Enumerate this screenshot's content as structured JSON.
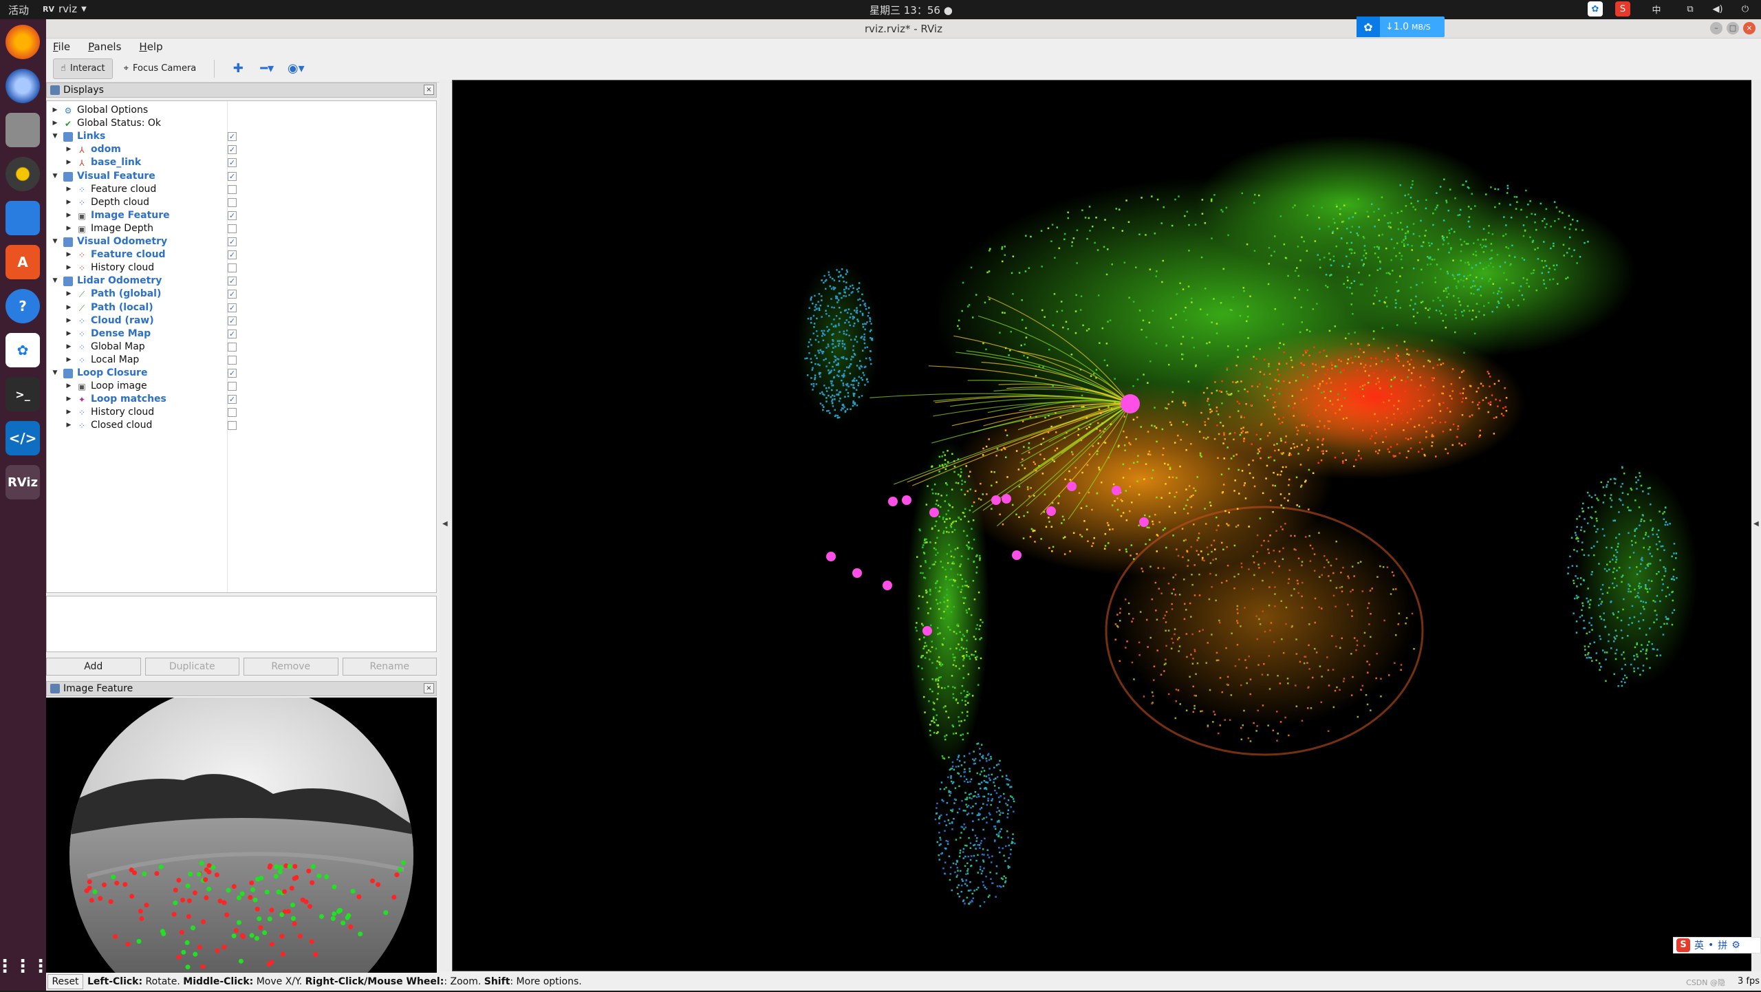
{
  "topbar": {
    "activities": "活动",
    "app_name": "rviz",
    "clock": "星期三 13：56 ●",
    "input_method": "中"
  },
  "window": {
    "title": "rviz.rviz* - RViz"
  },
  "menu": {
    "file": "File",
    "panels": "Panels",
    "help": "Help"
  },
  "toolbar": {
    "interact": "Interact",
    "focus_camera": "Focus Camera"
  },
  "netspeed": {
    "value": "↓1.0",
    "unit": "MB/S"
  },
  "displays_panel": {
    "title": "Displays",
    "rows": [
      {
        "label": "Global Options",
        "depth": 0,
        "expanded": false,
        "hl": false,
        "check": null,
        "icon": "gear-icon"
      },
      {
        "label": "Global Status: Ok",
        "depth": 0,
        "expanded": false,
        "hl": false,
        "check": null,
        "icon": "check-icon"
      },
      {
        "label": "Links",
        "depth": 0,
        "expanded": true,
        "hl": true,
        "check": true,
        "icon": "folder-icon"
      },
      {
        "label": "odom",
        "depth": 1,
        "expanded": false,
        "hl": true,
        "check": true,
        "icon": "axes-icon"
      },
      {
        "label": "base_link",
        "depth": 1,
        "expanded": false,
        "hl": true,
        "check": true,
        "icon": "axes-icon"
      },
      {
        "label": "Visual Feature",
        "depth": 0,
        "expanded": true,
        "hl": true,
        "check": true,
        "icon": "folder-icon"
      },
      {
        "label": "Feature cloud",
        "depth": 1,
        "expanded": false,
        "hl": false,
        "check": false,
        "icon": "pointcloud-icon"
      },
      {
        "label": "Depth cloud",
        "depth": 1,
        "expanded": false,
        "hl": false,
        "check": false,
        "icon": "pointcloud-icon"
      },
      {
        "label": "Image Feature",
        "depth": 1,
        "expanded": false,
        "hl": true,
        "check": true,
        "icon": "image-icon"
      },
      {
        "label": "Image Depth",
        "depth": 1,
        "expanded": false,
        "hl": false,
        "check": false,
        "icon": "image-icon"
      },
      {
        "label": "Visual Odometry",
        "depth": 0,
        "expanded": true,
        "hl": true,
        "check": true,
        "icon": "folder-icon"
      },
      {
        "label": "Feature cloud",
        "depth": 1,
        "expanded": false,
        "hl": true,
        "check": true,
        "icon": "pointcloud-red-icon"
      },
      {
        "label": "History cloud",
        "depth": 1,
        "expanded": false,
        "hl": false,
        "check": false,
        "icon": "pointcloud-red-icon"
      },
      {
        "label": "Lidar Odometry",
        "depth": 0,
        "expanded": true,
        "hl": true,
        "check": true,
        "icon": "folder-icon"
      },
      {
        "label": "Path (global)",
        "depth": 1,
        "expanded": false,
        "hl": true,
        "check": true,
        "icon": "path-icon"
      },
      {
        "label": "Path (local)",
        "depth": 1,
        "expanded": false,
        "hl": true,
        "check": true,
        "icon": "path-icon"
      },
      {
        "label": "Cloud (raw)",
        "depth": 1,
        "expanded": false,
        "hl": true,
        "check": true,
        "icon": "pointcloud-icon"
      },
      {
        "label": "Dense Map",
        "depth": 1,
        "expanded": false,
        "hl": true,
        "check": true,
        "icon": "pointcloud-icon"
      },
      {
        "label": "Global Map",
        "depth": 1,
        "expanded": false,
        "hl": false,
        "check": false,
        "icon": "pointcloud-icon"
      },
      {
        "label": "Local Map",
        "depth": 1,
        "expanded": false,
        "hl": false,
        "check": false,
        "icon": "pointcloud-icon"
      },
      {
        "label": "Loop Closure",
        "depth": 0,
        "expanded": true,
        "hl": true,
        "check": true,
        "icon": "folder-icon"
      },
      {
        "label": "Loop image",
        "depth": 1,
        "expanded": false,
        "hl": false,
        "check": false,
        "icon": "image-icon"
      },
      {
        "label": "Loop matches",
        "depth": 1,
        "expanded": false,
        "hl": true,
        "check": true,
        "icon": "markers-icon"
      },
      {
        "label": "History cloud",
        "depth": 1,
        "expanded": false,
        "hl": false,
        "check": false,
        "icon": "pointcloud-icon"
      },
      {
        "label": "Closed cloud",
        "depth": 1,
        "expanded": false,
        "hl": false,
        "check": false,
        "icon": "pointcloud-icon"
      }
    ],
    "buttons": {
      "add": "Add",
      "duplicate": "Duplicate",
      "remove": "Remove",
      "rename": "Rename"
    }
  },
  "image_panel": {
    "title": "Image Feature"
  },
  "statusbar": {
    "reset": "Reset",
    "hint_1_key": "Left-Click:",
    "hint_1_val": " Rotate. ",
    "hint_2_key": "Middle-Click:",
    "hint_2_val": " Move X/Y. ",
    "hint_3_key": "Right-Click/Mouse Wheel:",
    "hint_3_val": ": Zoom. ",
    "hint_4_key": "Shift",
    "hint_4_val": ": More options.",
    "fps": "3 fps",
    "watermark": "CSDN @隐"
  },
  "ime": {
    "lang": "英",
    "mode": "拼"
  },
  "colors": {
    "highlight_text": "#2c70c7",
    "viewport_bg": "#000000",
    "loop_marker": "#ff4fe6"
  }
}
